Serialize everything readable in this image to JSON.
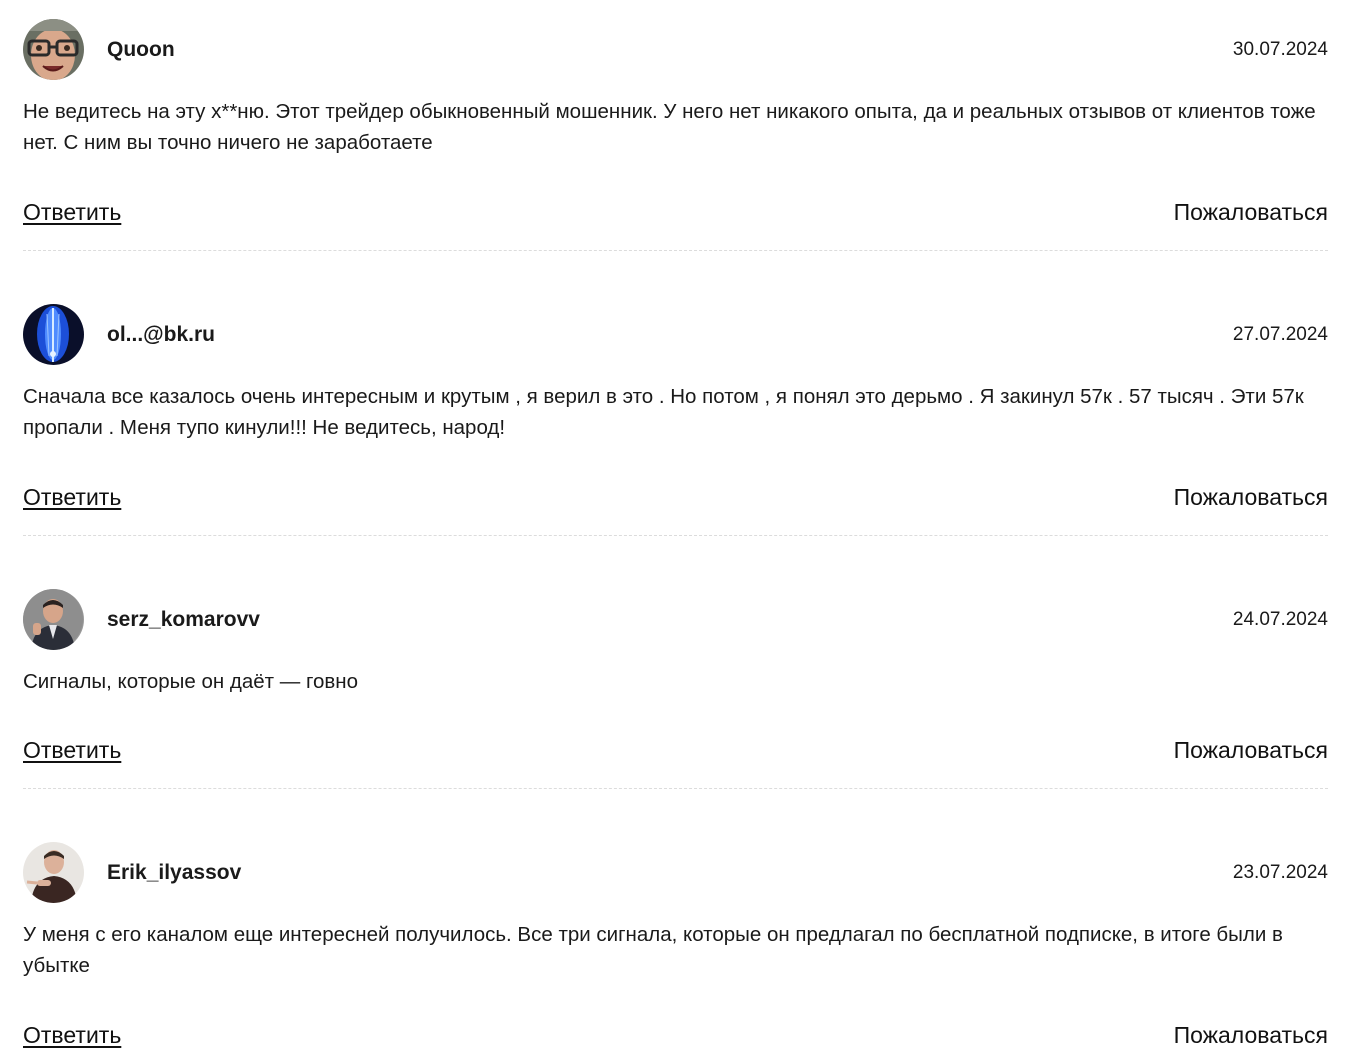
{
  "comments": [
    {
      "author": "Quoon",
      "date": "30.07.2024",
      "text": "Не ведитесь на эту х**ню. Этот трейдер обыкновенный мошенник. У него нет никакого опыта, да и реальных отзывов от клиентов тоже нет. С ним вы точно ничего не заработаете",
      "reply_label": "Ответить",
      "report_label": "Пожаловаться",
      "avatar_icon": "avatar-glasses-face-icon"
    },
    {
      "author": "ol...@bk.ru",
      "date": "27.07.2024",
      "text": "Сначала все казалось очень интересным и крутым , я верил в это . Но потом , я понял это дерьмо . Я закинул 57к . 57 тысяч . Эти 57к пропали . Меня тупо кинули!!! Не ведитесь, народ!",
      "reply_label": "Ответить",
      "report_label": "Пожаловаться",
      "avatar_icon": "avatar-blue-light-icon"
    },
    {
      "author": "serz_komarovv",
      "date": "24.07.2024",
      "text": "Сигналы, которые он даёт — говно",
      "reply_label": "Ответить",
      "report_label": "Пожаловаться",
      "avatar_icon": "avatar-man-suit-icon"
    },
    {
      "author": "Erik_ilyassov",
      "date": "23.07.2024",
      "text": "У меня с его каналом еще интересней получилось. Все три сигнала, которые он предлагал по бесплатной подписке, в итоге были в убытке",
      "reply_label": "Ответить",
      "report_label": "Пожаловаться",
      "avatar_icon": "avatar-man-pointing-icon"
    }
  ]
}
